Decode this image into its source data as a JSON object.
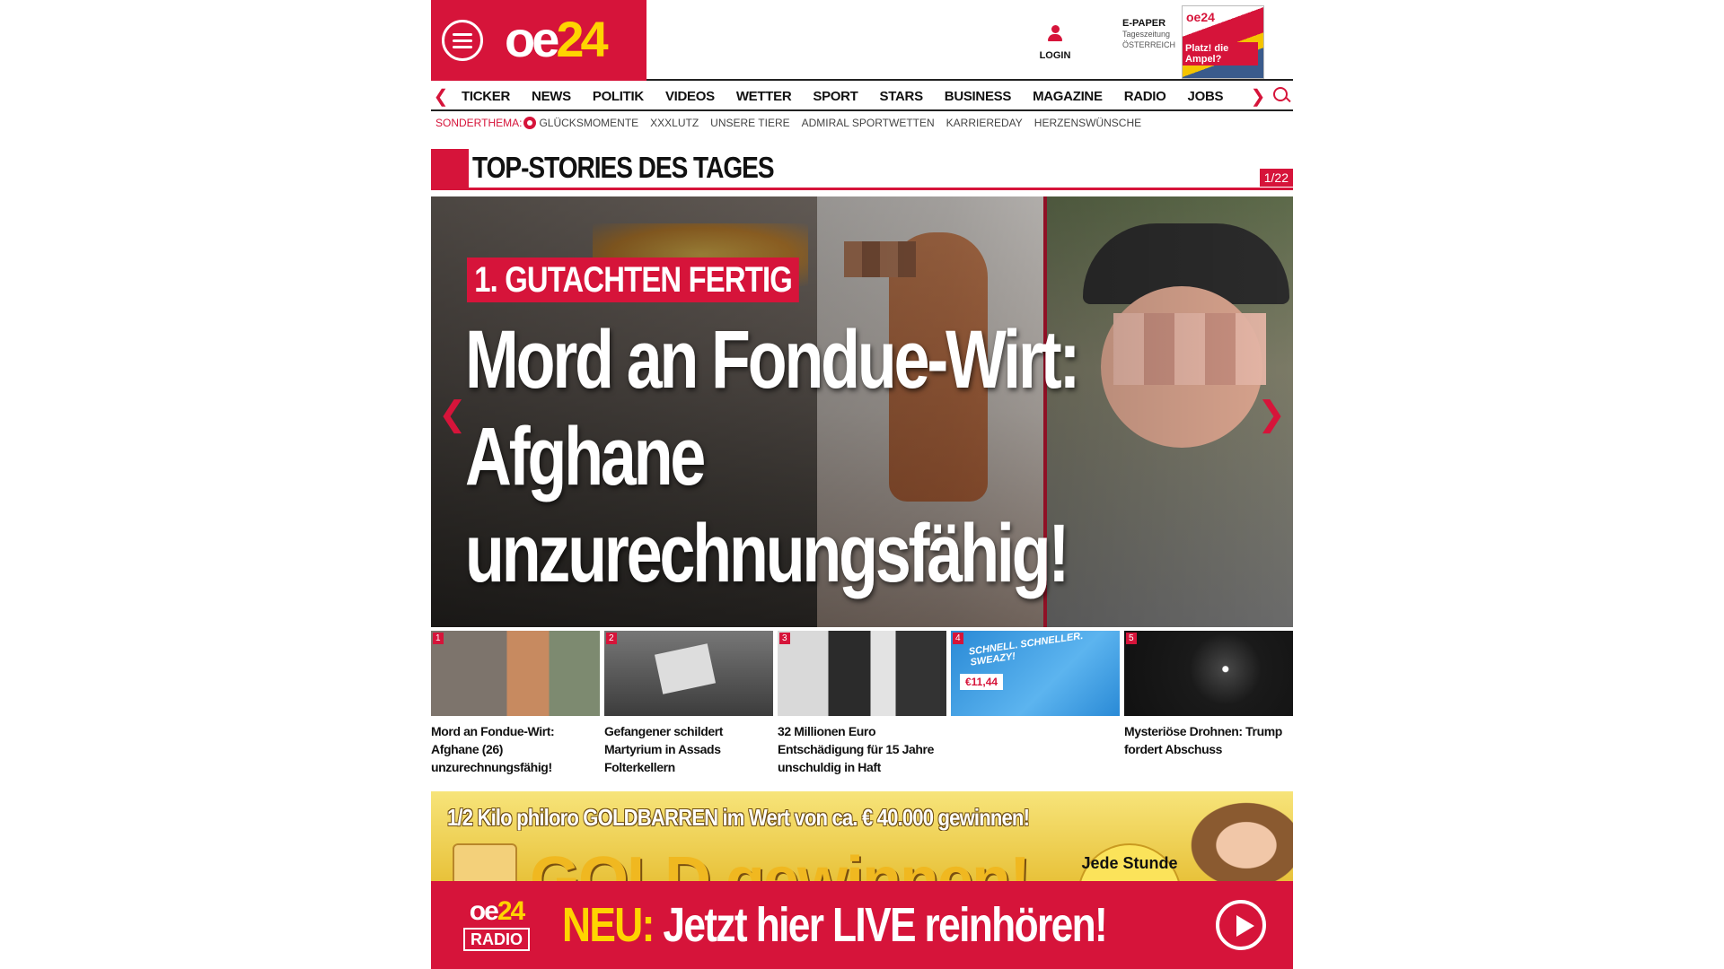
{
  "header": {
    "logo_oe": "oe",
    "logo_num": "24",
    "login_label": "LOGIN",
    "epaper_title": "E-PAPER",
    "epaper_sub1": "Tageszeitung",
    "epaper_sub2": "ÖSTERREICH",
    "epaper_thumb_logo": "oe24",
    "epaper_thumb_headline": "Platz! die Ampel?"
  },
  "nav": {
    "items": [
      "TICKER",
      "NEWS",
      "POLITIK",
      "VIDEOS",
      "WETTER",
      "SPORT",
      "STARS",
      "BUSINESS",
      "MAGAZINE",
      "RADIO",
      "JOBS"
    ]
  },
  "subnav": {
    "label": "SONDERTHEMA:",
    "items": [
      "GLÜCKSMOMENTE",
      "XXXLUTZ",
      "UNSERE TIERE",
      "ADMIRAL SPORTWETTEN",
      "KARRIEREDAY",
      "HERZENSWÜNSCHE"
    ]
  },
  "section": {
    "title": "TOP-STORIES DES TAGES",
    "counter": "1/22"
  },
  "hero": {
    "kicker": "1. GUTACHTEN FERTIG",
    "headline": "Mord an Fondue-Wirt: Afghane unzurechnungsfähig!"
  },
  "thumbs": [
    {
      "num": "1",
      "caption": "Mord an Fondue-Wirt: Afghane (26) unzurechnungsfähig!"
    },
    {
      "num": "2",
      "caption": "Gefangener schildert Martyrium in Assads Folterkellern"
    },
    {
      "num": "3",
      "caption": "32 Millionen Euro Entschädigung für 15 Jahre unschuldig in Haft"
    },
    {
      "num": "4",
      "caption": "",
      "ad_text": "SCHNELL. SCHNELLER. SWEAZY!",
      "ad_price": "€11,44"
    },
    {
      "num": "5",
      "caption": "Mysteriöse Drohnen: Trump fordert Abschuss"
    }
  ],
  "ad": {
    "top_text": "1/2 Kilo philoro GOLDBARREN im Wert von ca. € 40.000 gewinnen!",
    "big_text": "GOLD gewinnen!",
    "badge_text": "Jede Stunde"
  },
  "radio": {
    "logo_oe": "oe",
    "logo_num": "24",
    "logo_radio": "RADIO",
    "neu": "NEU:",
    "text": "Jetzt hier LIVE reinhören!"
  },
  "colors": {
    "brand_red": "#d6143a",
    "brand_yellow": "#ffd400"
  }
}
